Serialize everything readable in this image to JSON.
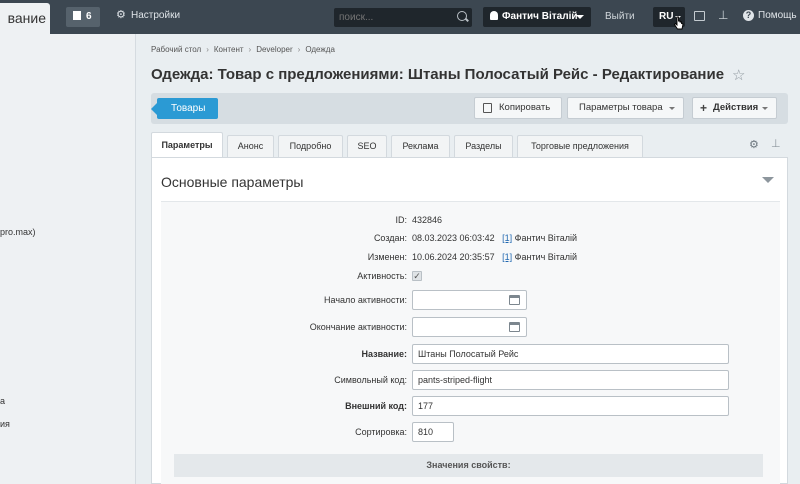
{
  "topbar": {
    "tab_label": "вание",
    "notifications_count": "6",
    "settings_label": "Настройки",
    "search_placeholder": "поиск...",
    "user_name": "Фантич Віталій",
    "exit_label": "Выйти",
    "lang": "RU",
    "help_label": "Помощь"
  },
  "left_panel": {
    "items": [
      "pro.max)",
      "а",
      "ия"
    ]
  },
  "breadcrumbs": [
    "Рабочий стол",
    "Контент",
    "Developer",
    "Одежда"
  ],
  "page_title": "Одежда: Товар с предложениями: Штаны Полосатый Рейс - Редактирование",
  "toolbar": {
    "back_label": "Товары",
    "copy_label": "Копировать",
    "params_label": "Параметры товара",
    "actions_label": "Действия"
  },
  "tabs": [
    "Параметры",
    "Анонс",
    "Подробно",
    "SEO",
    "Реклама",
    "Разделы",
    "Торговые предложения"
  ],
  "section": {
    "title": "Основные параметры"
  },
  "form": {
    "id_label": "ID:",
    "id_value": "432846",
    "created_label": "Создан:",
    "created_date": "08.03.2023 06:03:42",
    "created_user_id": "[1]",
    "created_user": "Фантич Віталій",
    "modified_label": "Изменен:",
    "modified_date": "10.06.2024 20:35:57",
    "modified_user_id": "[1]",
    "modified_user": "Фантич Віталій",
    "active_label": "Активность:",
    "active_start_label": "Начало активности:",
    "active_end_label": "Окончание активности:",
    "name_label": "Название:",
    "name_value": "Штаны Полосатый Рейс",
    "code_label": "Символьный код:",
    "code_value": "pants-striped-flight",
    "xml_label": "Внешний код:",
    "xml_value": "177",
    "sort_label": "Сортировка:",
    "sort_value": "810",
    "props_heading": "Значения свойств:"
  },
  "colors": {
    "topbar": "#3c4751",
    "accent": "#2b9ad4",
    "link": "#2067b0"
  }
}
